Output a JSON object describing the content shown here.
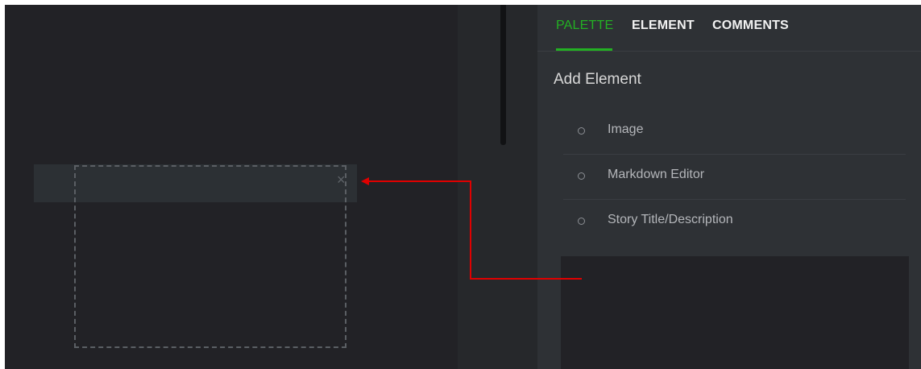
{
  "tabs": [
    {
      "label": "PALETTE",
      "active": true
    },
    {
      "label": "ELEMENT",
      "active": false
    },
    {
      "label": "COMMENTS",
      "active": false
    }
  ],
  "panel": {
    "section_title": "Add Element",
    "items": [
      {
        "label": "Image",
        "icon": "circle-outline-icon"
      },
      {
        "label": "Markdown Editor",
        "icon": "circle-outline-icon"
      },
      {
        "label": "Story Title/Description",
        "icon": "circle-outline-icon"
      }
    ]
  },
  "canvas": {
    "close_icon": "×"
  },
  "colors": {
    "accent": "#23b023",
    "canvas_bg": "#222226",
    "panel_bg": "#2e3135",
    "annotation_arrow": "#e00000"
  }
}
